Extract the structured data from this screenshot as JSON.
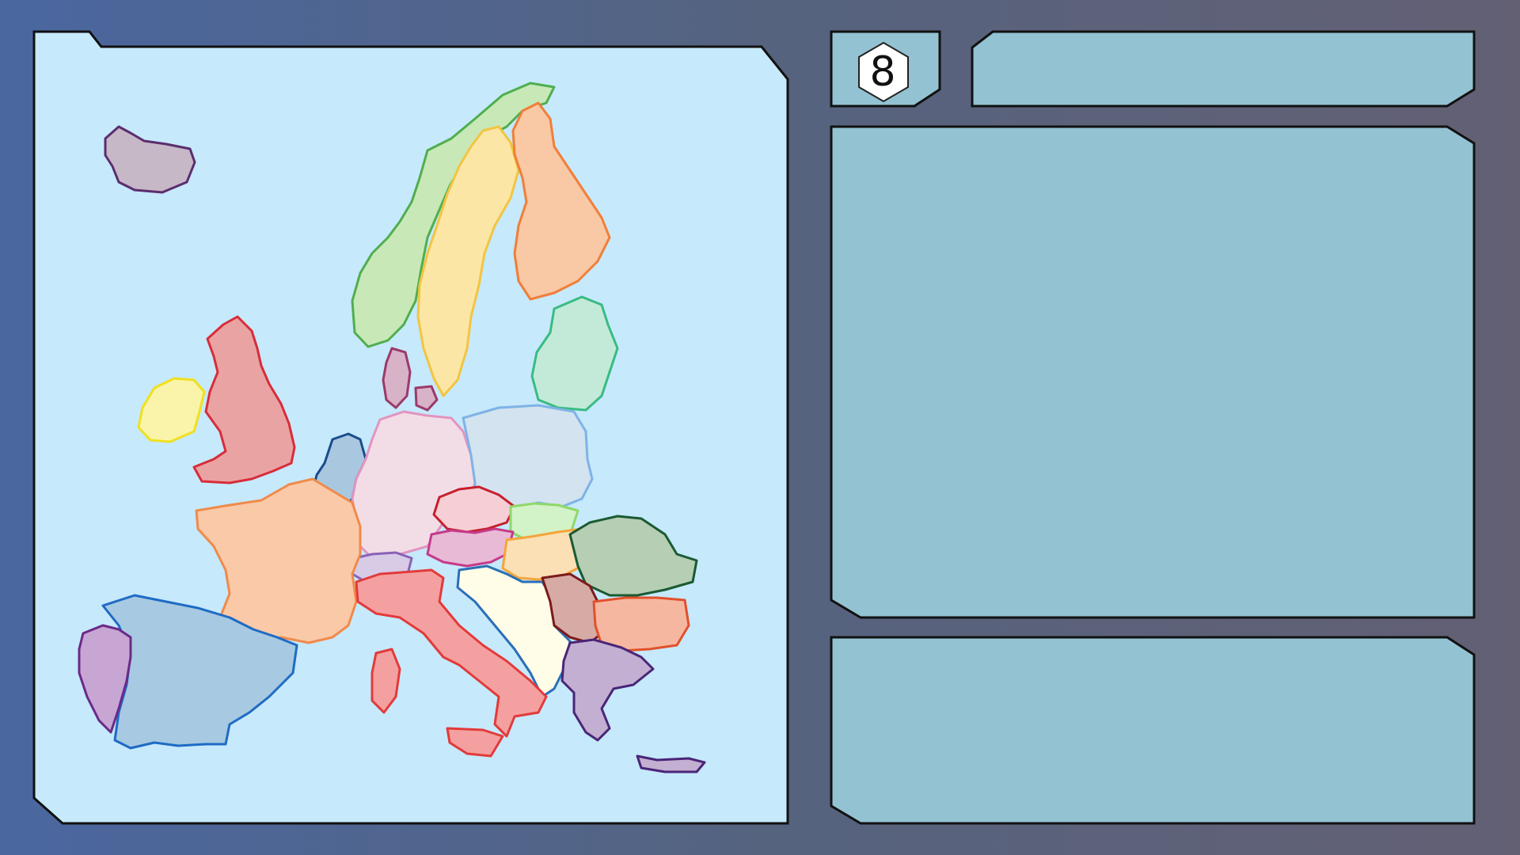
{
  "game": {
    "turn_number": "8",
    "title_panel": "",
    "info_panel": "",
    "status_panel": ""
  },
  "colors": {
    "background_left": "#4a67a0",
    "background_right": "#636074",
    "map_sea": "#c6e9fb",
    "panel_fill": "#93c2d3",
    "panel_stroke": "#111111",
    "hex_badge": "#ffffff"
  },
  "map": {
    "regions": [
      {
        "name": "iceland",
        "fill": "#c7b8c8",
        "stroke": "#5b2d6e"
      },
      {
        "name": "norway",
        "fill": "#c8e8b7",
        "stroke": "#4fae4f"
      },
      {
        "name": "sweden",
        "fill": "#fbe6a6",
        "stroke": "#f2c541"
      },
      {
        "name": "finland",
        "fill": "#f9c8a4",
        "stroke": "#ef7f3a"
      },
      {
        "name": "baltics",
        "fill": "#c3ead9",
        "stroke": "#39bb83"
      },
      {
        "name": "united-kingdom",
        "fill": "#eaa3a3",
        "stroke": "#d72d3a"
      },
      {
        "name": "ireland",
        "fill": "#faf4aa",
        "stroke": "#f0e01e"
      },
      {
        "name": "denmark",
        "fill": "#d8b2c6",
        "stroke": "#9b3a6a"
      },
      {
        "name": "benelux",
        "fill": "#a9c8e0",
        "stroke": "#1b4d8c"
      },
      {
        "name": "germany",
        "fill": "#f2dde6",
        "stroke": "#e294c0"
      },
      {
        "name": "poland",
        "fill": "#d3e3ef",
        "stroke": "#7fb3e6"
      },
      {
        "name": "czechia",
        "fill": "#f5cfd5",
        "stroke": "#c61f2e"
      },
      {
        "name": "slovakia",
        "fill": "#d2f2c7",
        "stroke": "#8fd86a"
      },
      {
        "name": "austria",
        "fill": "#e8bad6",
        "stroke": "#c63a8a"
      },
      {
        "name": "switzerland",
        "fill": "#d7cbe6",
        "stroke": "#8a62b6"
      },
      {
        "name": "france",
        "fill": "#f9c9a8",
        "stroke": "#f08a4a"
      },
      {
        "name": "hungary",
        "fill": "#fbdfb5",
        "stroke": "#f4a53a"
      },
      {
        "name": "romania",
        "fill": "#b6ceb4",
        "stroke": "#1a5a32"
      },
      {
        "name": "balkans",
        "fill": "#fffce8",
        "stroke": "#2a6fb5"
      },
      {
        "name": "serbia",
        "fill": "#d6aaa5",
        "stroke": "#7d1a1a"
      },
      {
        "name": "bulgaria",
        "fill": "#f6b7a0",
        "stroke": "#e2502b"
      },
      {
        "name": "italy",
        "fill": "#f4a0a0",
        "stroke": "#e33a3a"
      },
      {
        "name": "spain",
        "fill": "#a7c9e2",
        "stroke": "#1e6bc4"
      },
      {
        "name": "portugal",
        "fill": "#c7a6d3",
        "stroke": "#6b2a8a"
      },
      {
        "name": "greece",
        "fill": "#c3afd1",
        "stroke": "#4a2578"
      }
    ]
  }
}
